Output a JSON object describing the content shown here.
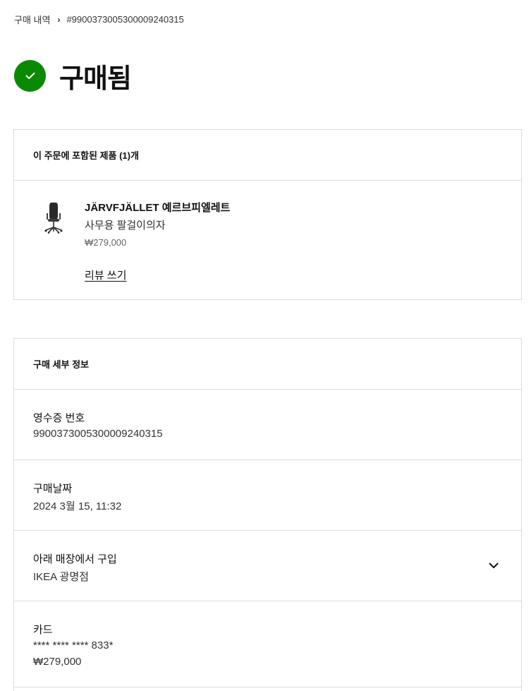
{
  "breadcrumb": {
    "parent": "구매 내역",
    "current": "#99003730053000092403​15"
  },
  "status": {
    "title": "구매됨",
    "color": "#0a8a00"
  },
  "products": {
    "header": "이 주문에 포함된 제품 (1)개",
    "items": [
      {
        "name": "JÄRVFJÄLLET 예르브피엘레트",
        "description": "사무용 팔걸이의자",
        "price": "₩279,000",
        "review_label": "리뷰 쓰기",
        "icon": "office-chair-icon"
      }
    ]
  },
  "details": {
    "header": "구매 세부 정보",
    "receipt": {
      "label": "영수증 번호",
      "value": "9900373005300009240315"
    },
    "date": {
      "label": "구매날짜",
      "value": "2024 3월 15, 11:32"
    },
    "store": {
      "label": "아래 매장에서 구입",
      "value": "IKEA 광명점"
    },
    "card": {
      "label": "카드",
      "number": "**** **** **** 833*",
      "amount": "₩279,000"
    }
  }
}
